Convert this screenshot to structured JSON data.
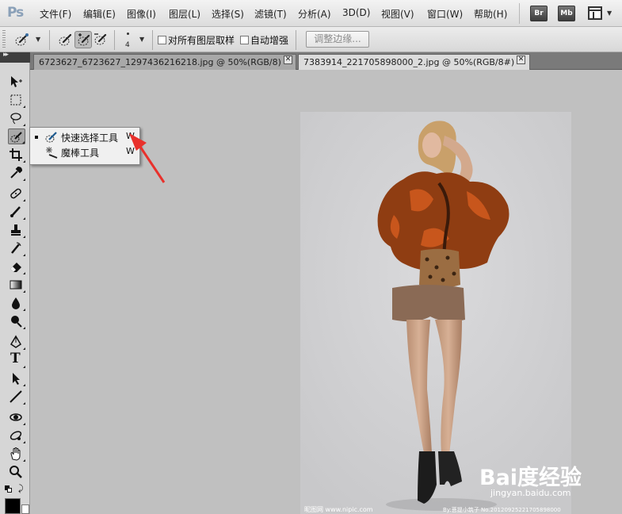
{
  "app": {
    "logo": "Ps"
  },
  "menu": {
    "items": [
      "文件(F)",
      "编辑(E)",
      "图像(I)",
      "图层(L)",
      "选择(S)",
      "滤镜(T)",
      "分析(A)",
      "3D(D)",
      "视图(V)",
      "窗口(W)",
      "帮助(H)"
    ],
    "bridge_label": "Br",
    "minibridge_label": "Mb"
  },
  "options": {
    "brush_size": "4",
    "sample_all_layers": {
      "label": "对所有图层取样",
      "checked": false
    },
    "auto_enhance": {
      "label": "自动增强",
      "checked": false
    },
    "refine_edge_label": "调整边缘..."
  },
  "tabs": [
    {
      "label": "6723627_6723627_1297436216218.jpg @ 50%(RGB/8)",
      "active": false
    },
    {
      "label": "7383914_221705898000_2.jpg @ 50%(RGB/8#)",
      "active": true
    }
  ],
  "flyout": {
    "items": [
      {
        "label": "快速选择工具",
        "shortcut": "W",
        "selected": true,
        "icon": "quick-selection-icon"
      },
      {
        "label": "魔棒工具",
        "shortcut": "W",
        "selected": false,
        "icon": "magic-wand-icon"
      }
    ]
  },
  "document": {
    "watermark_left": "昵图网 www.nipic.com",
    "watermark_right": "By:菩提小筑子 No.20120925221705898000"
  },
  "overlay": {
    "brand": "Bai度经验",
    "url": "jingyan.baidu.com",
    "arrow_color": "#e8312c"
  }
}
